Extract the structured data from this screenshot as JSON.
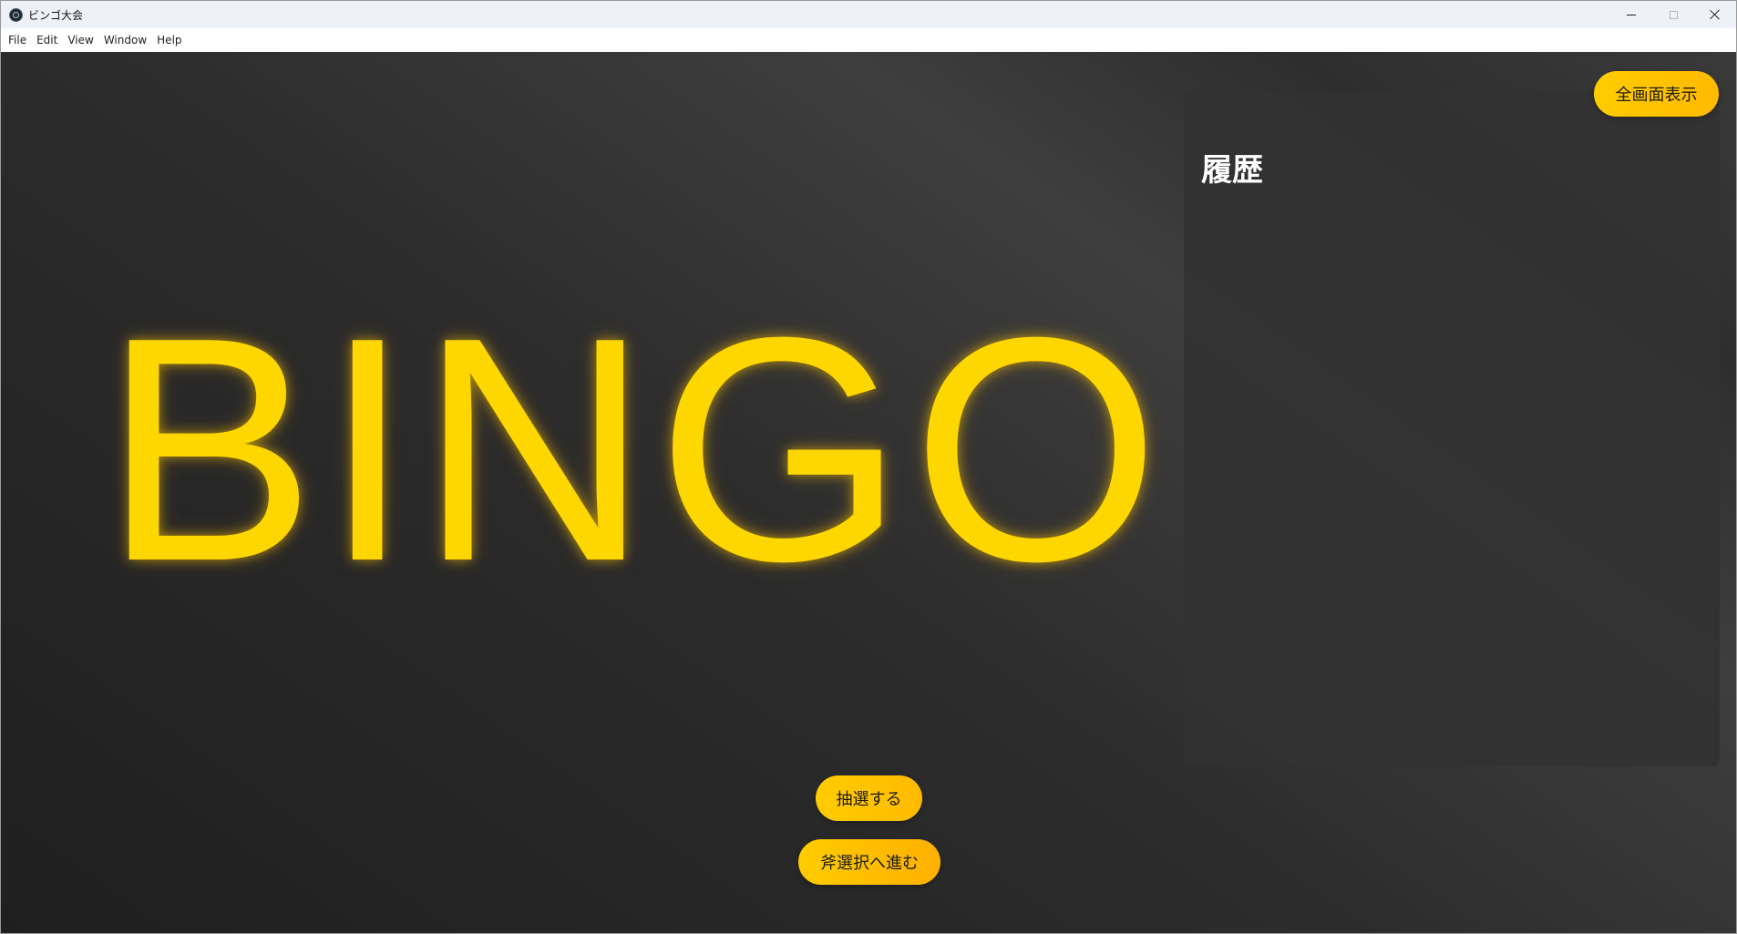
{
  "window": {
    "title": "ビンゴ大会",
    "icon": "app-icon"
  },
  "menu": {
    "items": [
      "File",
      "Edit",
      "View",
      "Window",
      "Help"
    ]
  },
  "main": {
    "display_text": "BINGO",
    "display_color": "#ffd700",
    "fullscreen_label": "全画面表示",
    "history_title": "履歴",
    "history_items": [],
    "draw_label": "抽選する",
    "next_label": "斧選択へ進む",
    "accent_color": "#ffc800",
    "background_color": "#2b2b2b"
  }
}
